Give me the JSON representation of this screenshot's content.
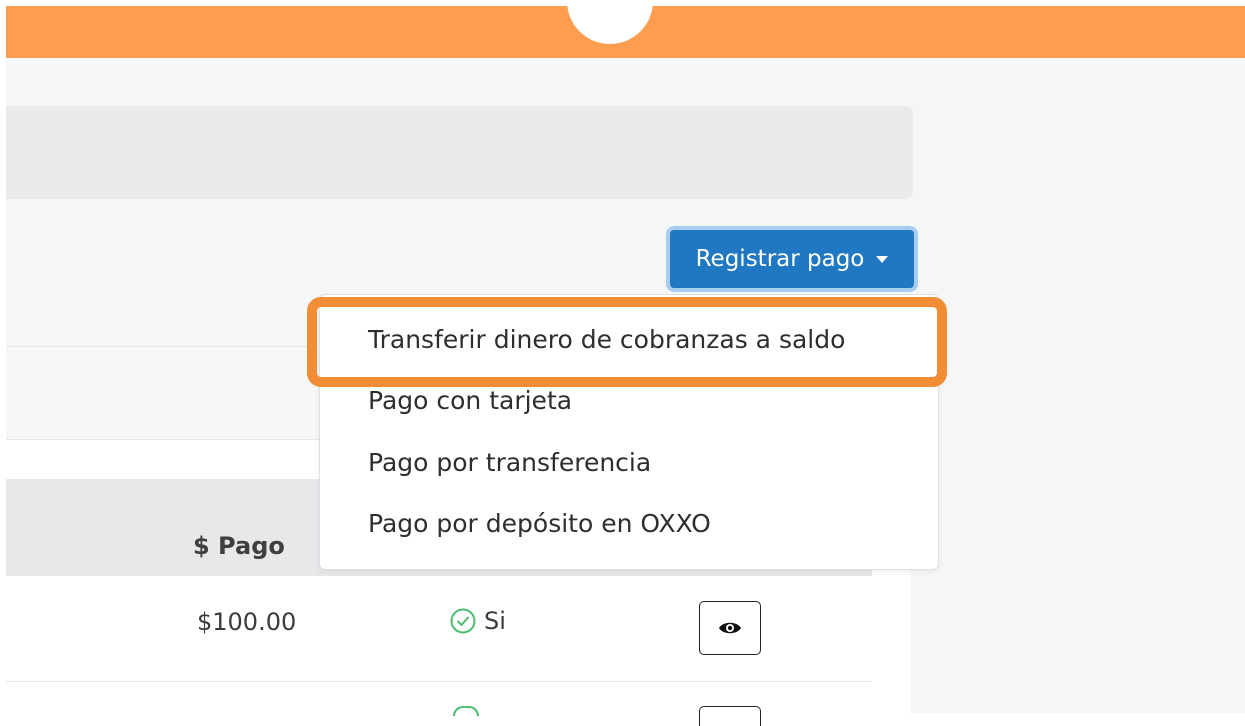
{
  "header": {
    "accent_color": "#fd9d50",
    "avatar_icon": "user-avatar"
  },
  "actions": {
    "register_payment_label": "Registrar pago",
    "button_color": "#1f78c1"
  },
  "dropdown": {
    "items": [
      {
        "label": "Transferir dinero de cobranzas a saldo",
        "highlighted": true
      },
      {
        "label": "Pago con tarjeta"
      },
      {
        "label": "Pago por transferencia"
      },
      {
        "label": "Pago por depósito en OXXO"
      }
    ],
    "highlight_color": "#f08d35"
  },
  "table": {
    "columns": {
      "payment": "$ Pago"
    },
    "rows": [
      {
        "payment": "$100.00",
        "paid": "Si",
        "paid_icon": "check-circle-icon",
        "action_icon": "eye-icon"
      }
    ]
  }
}
